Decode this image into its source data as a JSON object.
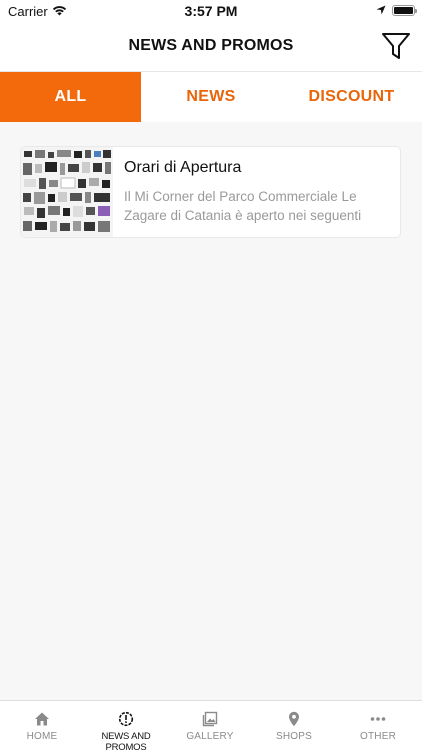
{
  "status_bar": {
    "carrier": "Carrier",
    "time": "3:57 PM"
  },
  "nav": {
    "title": "NEWS AND PROMOS"
  },
  "tabs": [
    {
      "label": "ALL",
      "active": true
    },
    {
      "label": "NEWS",
      "active": false
    },
    {
      "label": "DISCOUNT",
      "active": false
    }
  ],
  "feed": [
    {
      "title": "Orari di Apertura",
      "excerpt": "Il Mi Corner del Parco Commerciale Le Zagare di Catania è aperto nei seguenti"
    }
  ],
  "tab_bar": {
    "items": [
      {
        "label": "HOME",
        "icon": "home-icon",
        "active": false
      },
      {
        "label": "NEWS AND PROMOS",
        "icon": "alert-badge-icon",
        "active": true
      },
      {
        "label": "GALLERY",
        "icon": "gallery-icon",
        "active": false
      },
      {
        "label": "SHOPS",
        "icon": "map-pin-icon",
        "active": false
      },
      {
        "label": "OTHER",
        "icon": "more-icon",
        "active": false
      }
    ]
  },
  "colors": {
    "accent": "#f26a0c",
    "accent_text": "#e8650a",
    "inactive": "#8a8a8a"
  }
}
